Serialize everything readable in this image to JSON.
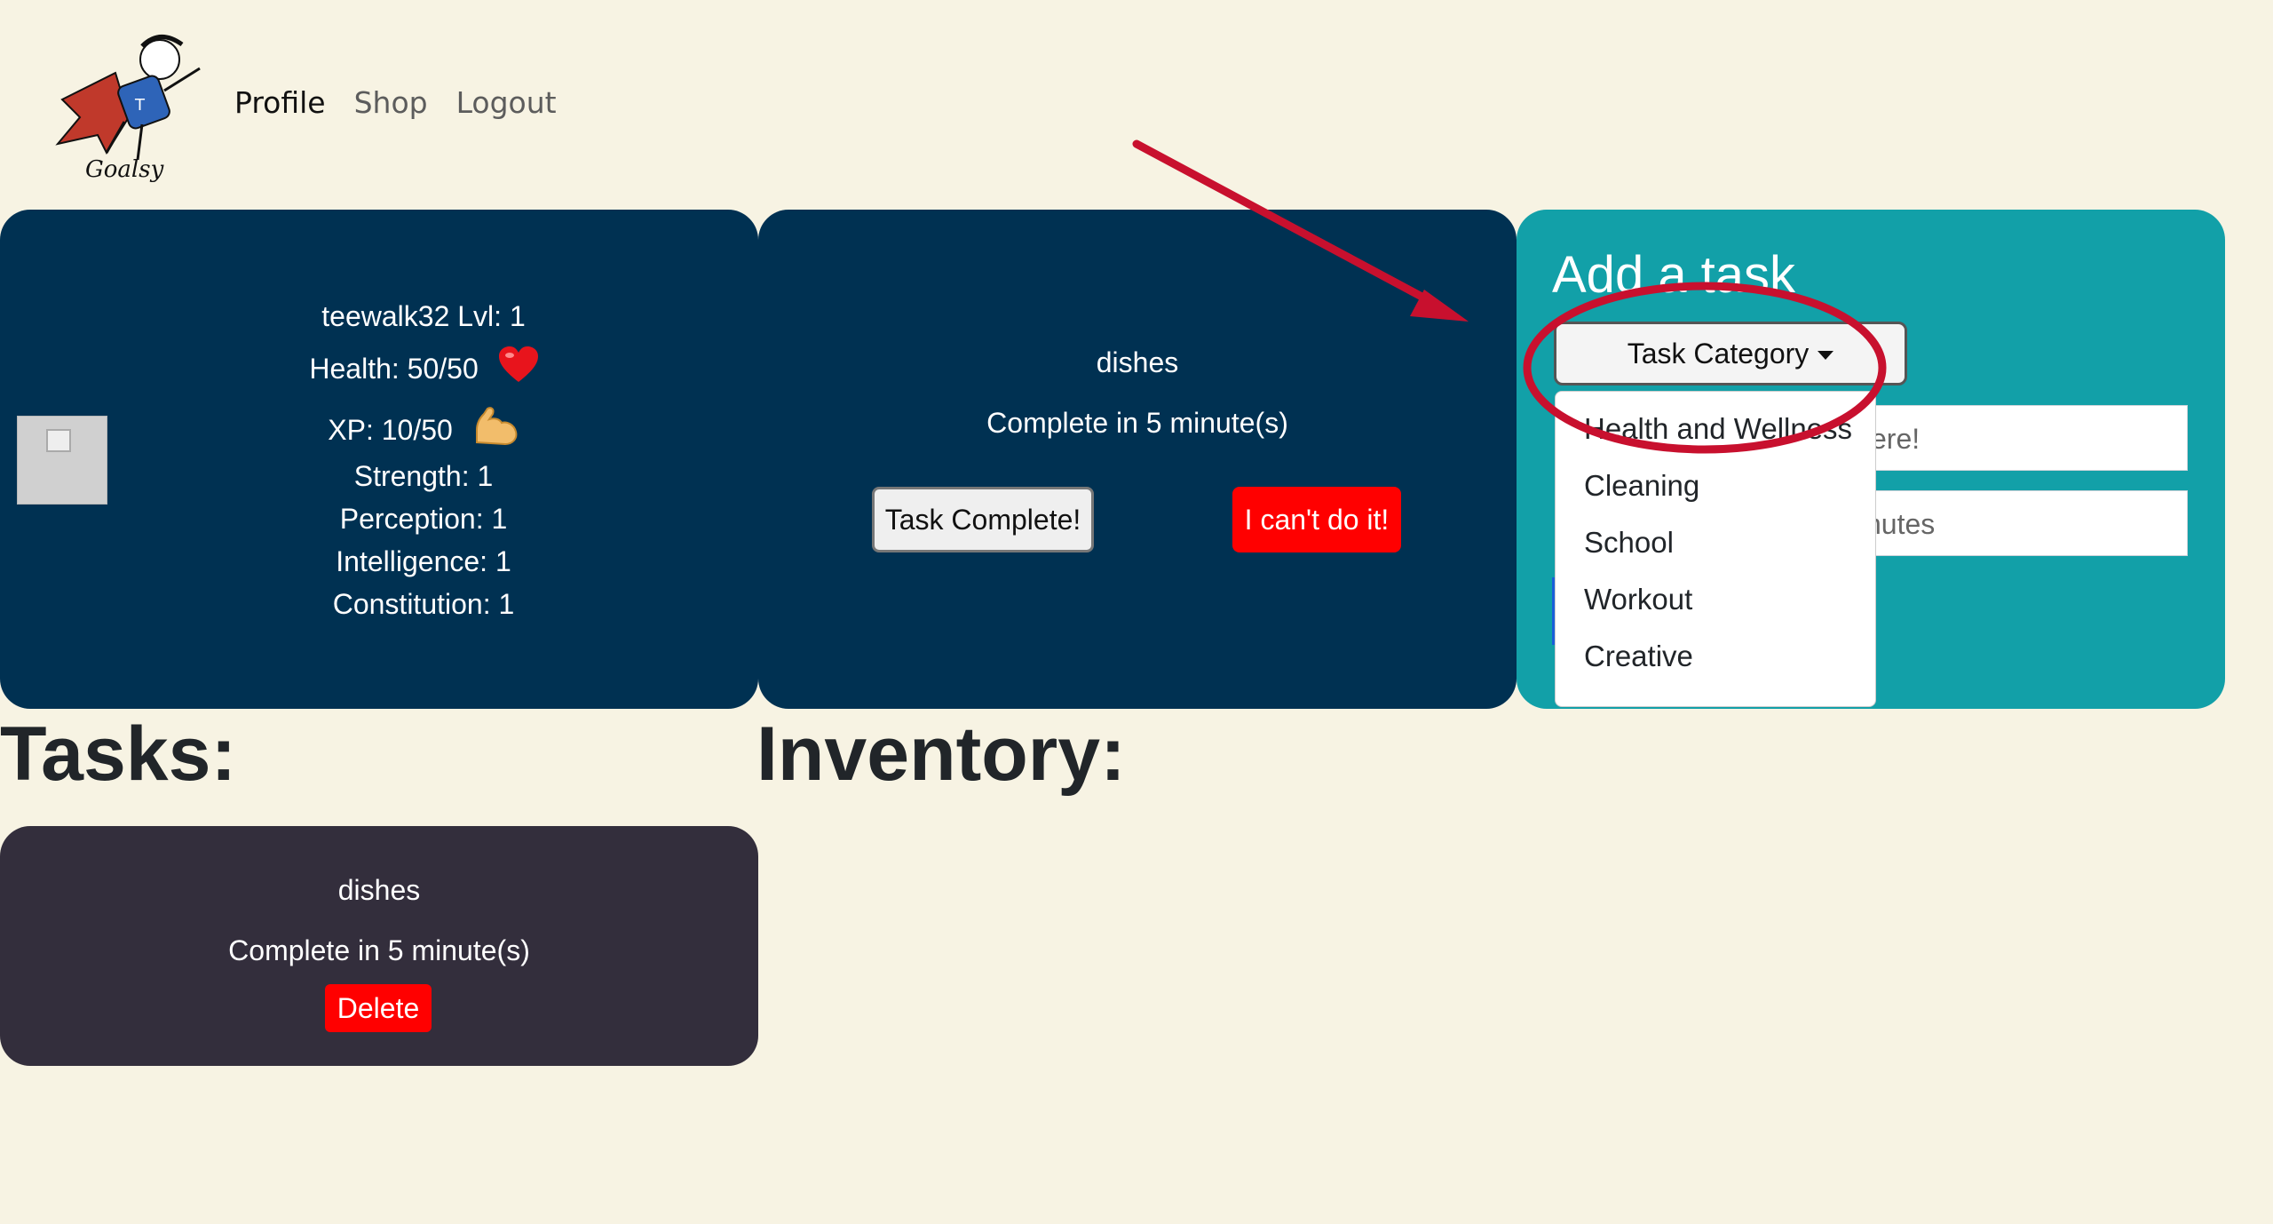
{
  "brand": {
    "name": "Goalsy"
  },
  "nav": {
    "profile": "Profile",
    "shop": "Shop",
    "logout": "Logout"
  },
  "profile": {
    "username_line": "teewalk32 Lvl: 1",
    "health": "Health: 50/50",
    "health_icon": "heart-icon",
    "xp": "XP: 10/50",
    "xp_icon": "flexed-biceps-icon",
    "strength": "Strength: 1",
    "perception": "Perception: 1",
    "intelligence": "Intelligence: 1",
    "constitution": "Constitution: 1"
  },
  "current_task": {
    "title": "dishes",
    "subtitle": "Complete in 5 minute(s)",
    "complete_label": "Task Complete!",
    "fail_label": "I can't do it!"
  },
  "add_task": {
    "title": "Add a task",
    "category_button": "Task Category",
    "name_placeholder_visible": "ere!",
    "minutes_placeholder_visible": "nutes",
    "categories": [
      "Health and Wellness",
      "Cleaning",
      "School",
      "Workout",
      "Creative"
    ]
  },
  "sections": {
    "tasks": "Tasks:",
    "inventory": "Inventory:"
  },
  "task_list": [
    {
      "title": "dishes",
      "subtitle": "Complete in 5 minute(s)",
      "delete_label": "Delete"
    }
  ],
  "colors": {
    "background": "#f7f3e3",
    "profile_card": "#003152",
    "add_card": "#12a0a8",
    "task_card": "#332e3c",
    "danger": "#ff0000",
    "annotation": "#c8102e"
  }
}
